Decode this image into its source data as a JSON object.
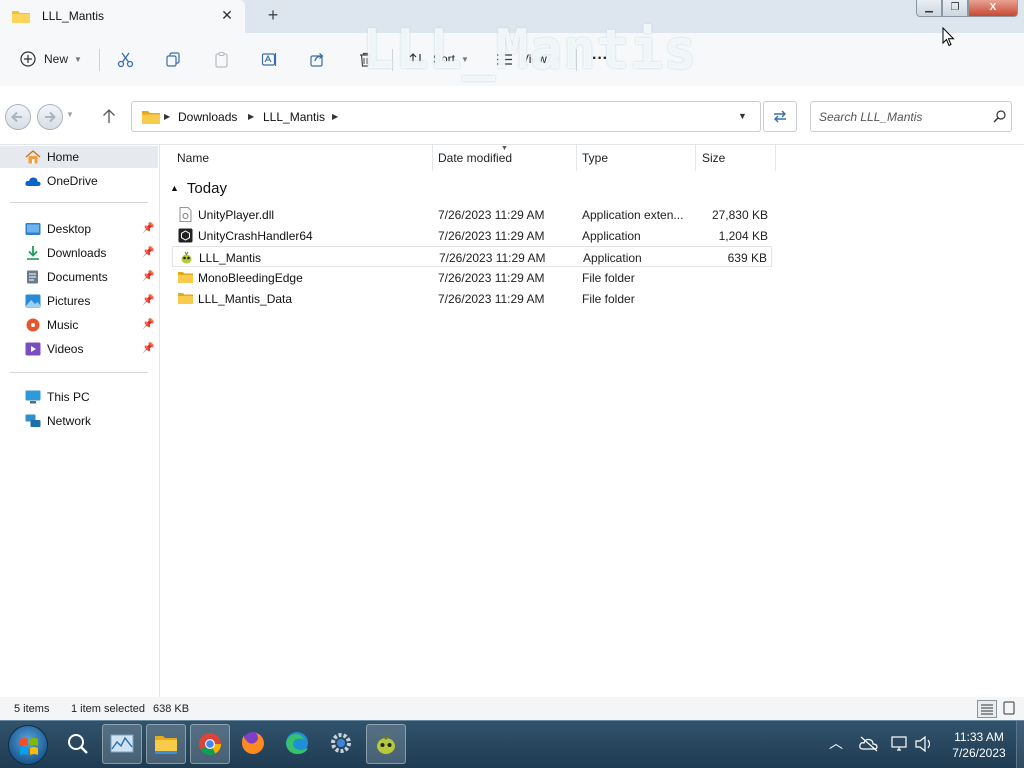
{
  "window": {
    "tab_title": "LLL_Mantis",
    "tab_close": "✕",
    "new_tab": "+",
    "minimize": "▁",
    "maximize": "❐",
    "close": "X",
    "watermark": "LLL_Mantis"
  },
  "toolbar": {
    "new_label": "New",
    "sort_label": "Sort",
    "view_label": "View",
    "more_label": "···"
  },
  "address": {
    "crumbs": [
      "Downloads",
      "LLL_Mantis"
    ],
    "search_placeholder": "Search LLL_Mantis"
  },
  "sidebar": {
    "items": [
      {
        "label": "Home",
        "icon": "home-icon",
        "pinned": false
      },
      {
        "label": "OneDrive",
        "icon": "cloud-icon",
        "pinned": false
      },
      {
        "label": "Desktop",
        "icon": "desktop-icon",
        "pinned": true
      },
      {
        "label": "Downloads",
        "icon": "download-icon",
        "pinned": true
      },
      {
        "label": "Documents",
        "icon": "document-icon",
        "pinned": true
      },
      {
        "label": "Pictures",
        "icon": "picture-icon",
        "pinned": true
      },
      {
        "label": "Music",
        "icon": "music-icon",
        "pinned": true
      },
      {
        "label": "Videos",
        "icon": "video-icon",
        "pinned": true
      },
      {
        "label": "This PC",
        "icon": "computer-icon",
        "pinned": false
      },
      {
        "label": "Network",
        "icon": "network-icon",
        "pinned": false
      }
    ],
    "pin_glyph": "📌"
  },
  "columns": {
    "name": "Name",
    "date": "Date modified",
    "type": "Type",
    "size": "Size"
  },
  "group": {
    "label": "Today"
  },
  "files": [
    {
      "name": "UnityPlayer.dll",
      "date": "7/26/2023 11:29 AM",
      "type": "Application exten...",
      "size": "27,830 KB",
      "icon": "dll-file-icon"
    },
    {
      "name": "UnityCrashHandler64",
      "date": "7/26/2023 11:29 AM",
      "type": "Application",
      "size": "1,204 KB",
      "icon": "unity-app-icon"
    },
    {
      "name": "LLL_Mantis",
      "date": "7/26/2023 11:29 AM",
      "type": "Application",
      "size": "639 KB",
      "icon": "mantis-app-icon"
    },
    {
      "name": "MonoBleedingEdge",
      "date": "7/26/2023 11:29 AM",
      "type": "File folder",
      "size": "",
      "icon": "folder-icon"
    },
    {
      "name": "LLL_Mantis_Data",
      "date": "7/26/2023 11:29 AM",
      "type": "File folder",
      "size": "",
      "icon": "folder-icon"
    }
  ],
  "status": {
    "count": "5 items",
    "selected": "1 item selected",
    "selected_size": "638 KB"
  },
  "taskbar": {
    "time": "11:33 AM",
    "date": "7/26/2023"
  },
  "colors": {
    "folder": "#f3c13a",
    "accent": "#0067c0"
  }
}
